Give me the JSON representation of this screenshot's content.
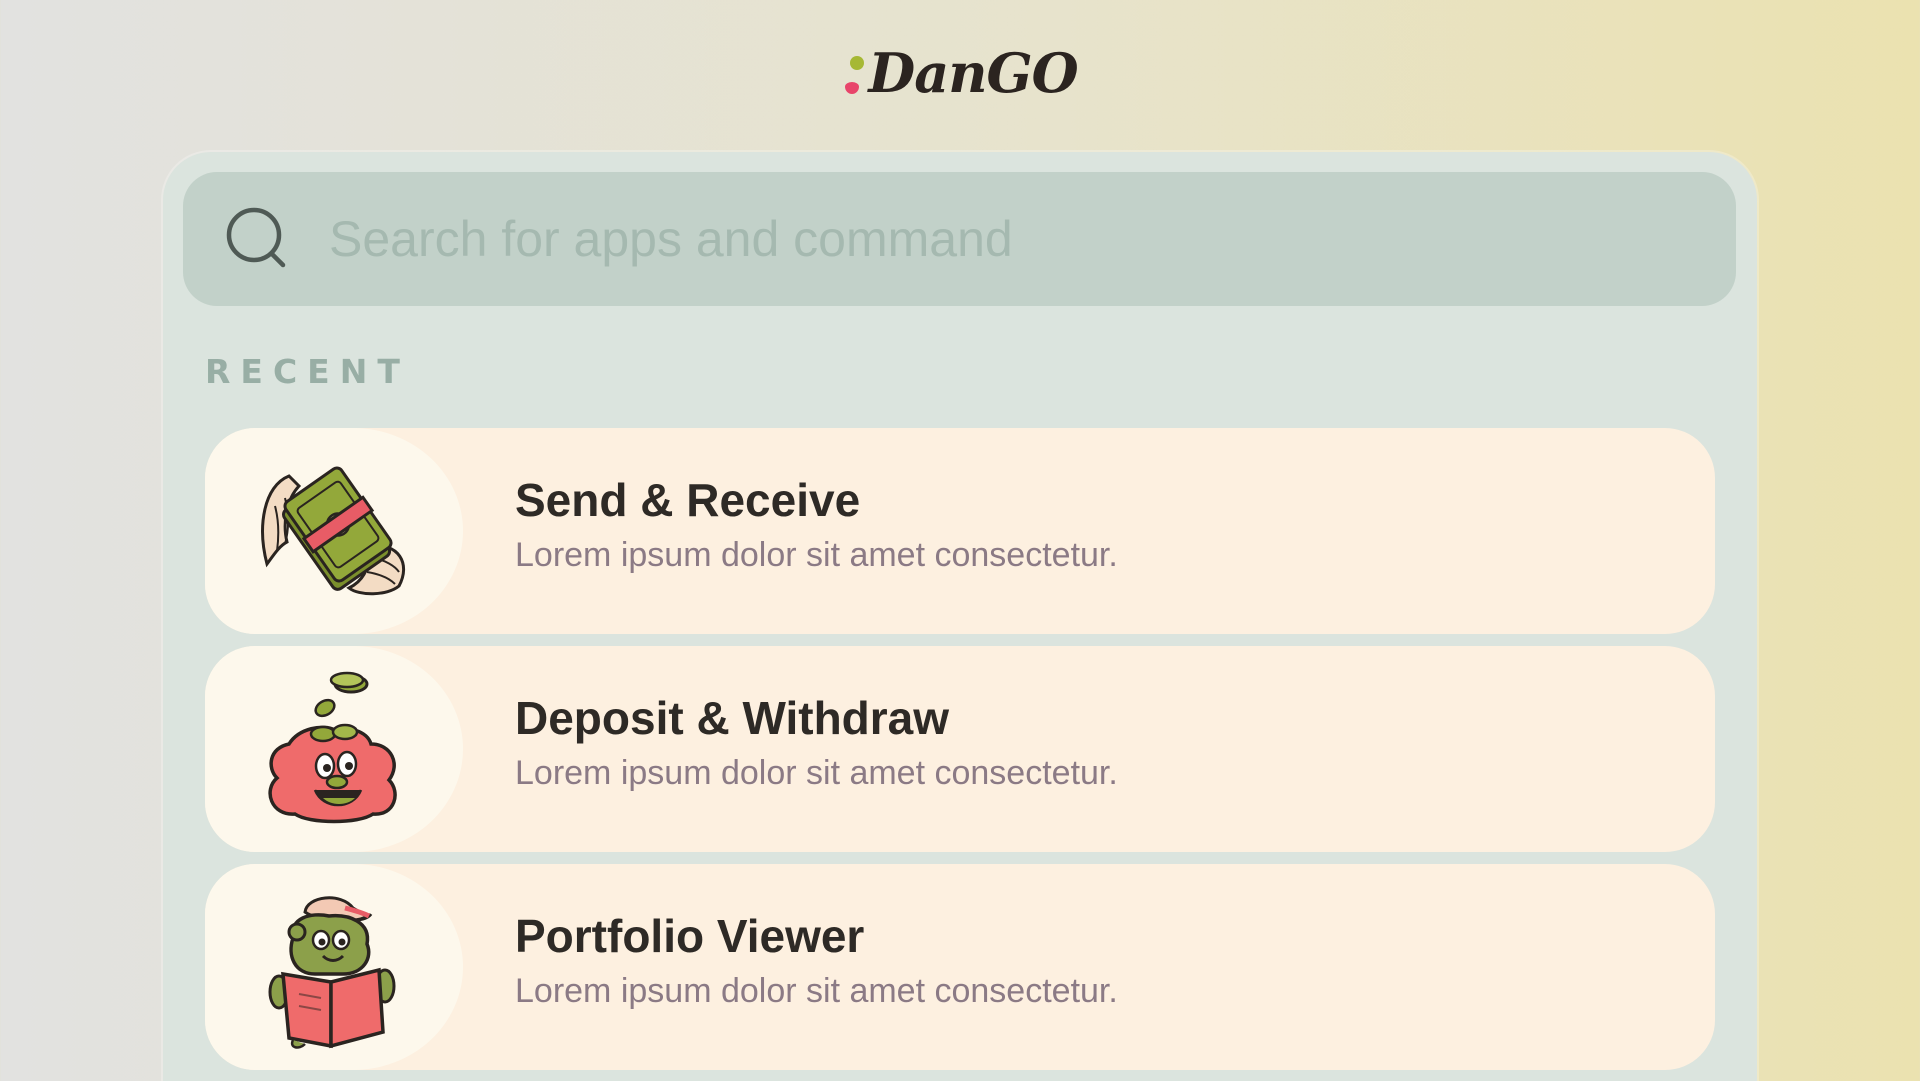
{
  "brand": {
    "name": "DanGO",
    "dot_top_color": "#a6b834",
    "dot_bottom_color": "#e8456a"
  },
  "search": {
    "placeholder": "Search for apps and command",
    "icon": "search-icon"
  },
  "recent": {
    "label": "RECENT",
    "items": [
      {
        "title": "Send & Receive",
        "description": "Lorem ipsum dolor sit amet consectetur.",
        "icon": "winged-money-icon"
      },
      {
        "title": "Deposit & Withdraw",
        "description": "Lorem ipsum dolor sit amet consectetur.",
        "icon": "money-bag-character-icon"
      },
      {
        "title": "Portfolio Viewer",
        "description": "Lorem ipsum dolor sit amet consectetur.",
        "icon": "frog-reading-book-icon"
      }
    ]
  },
  "colors": {
    "panel_bg": "#dbe4de",
    "search_bg": "#c2d1c9",
    "item_bg": "#fdf0e0",
    "thumb_bg": "#fdf8ec",
    "title_text": "#2e2a26",
    "desc_text": "#8b7a85",
    "section_label": "#98aea5"
  }
}
